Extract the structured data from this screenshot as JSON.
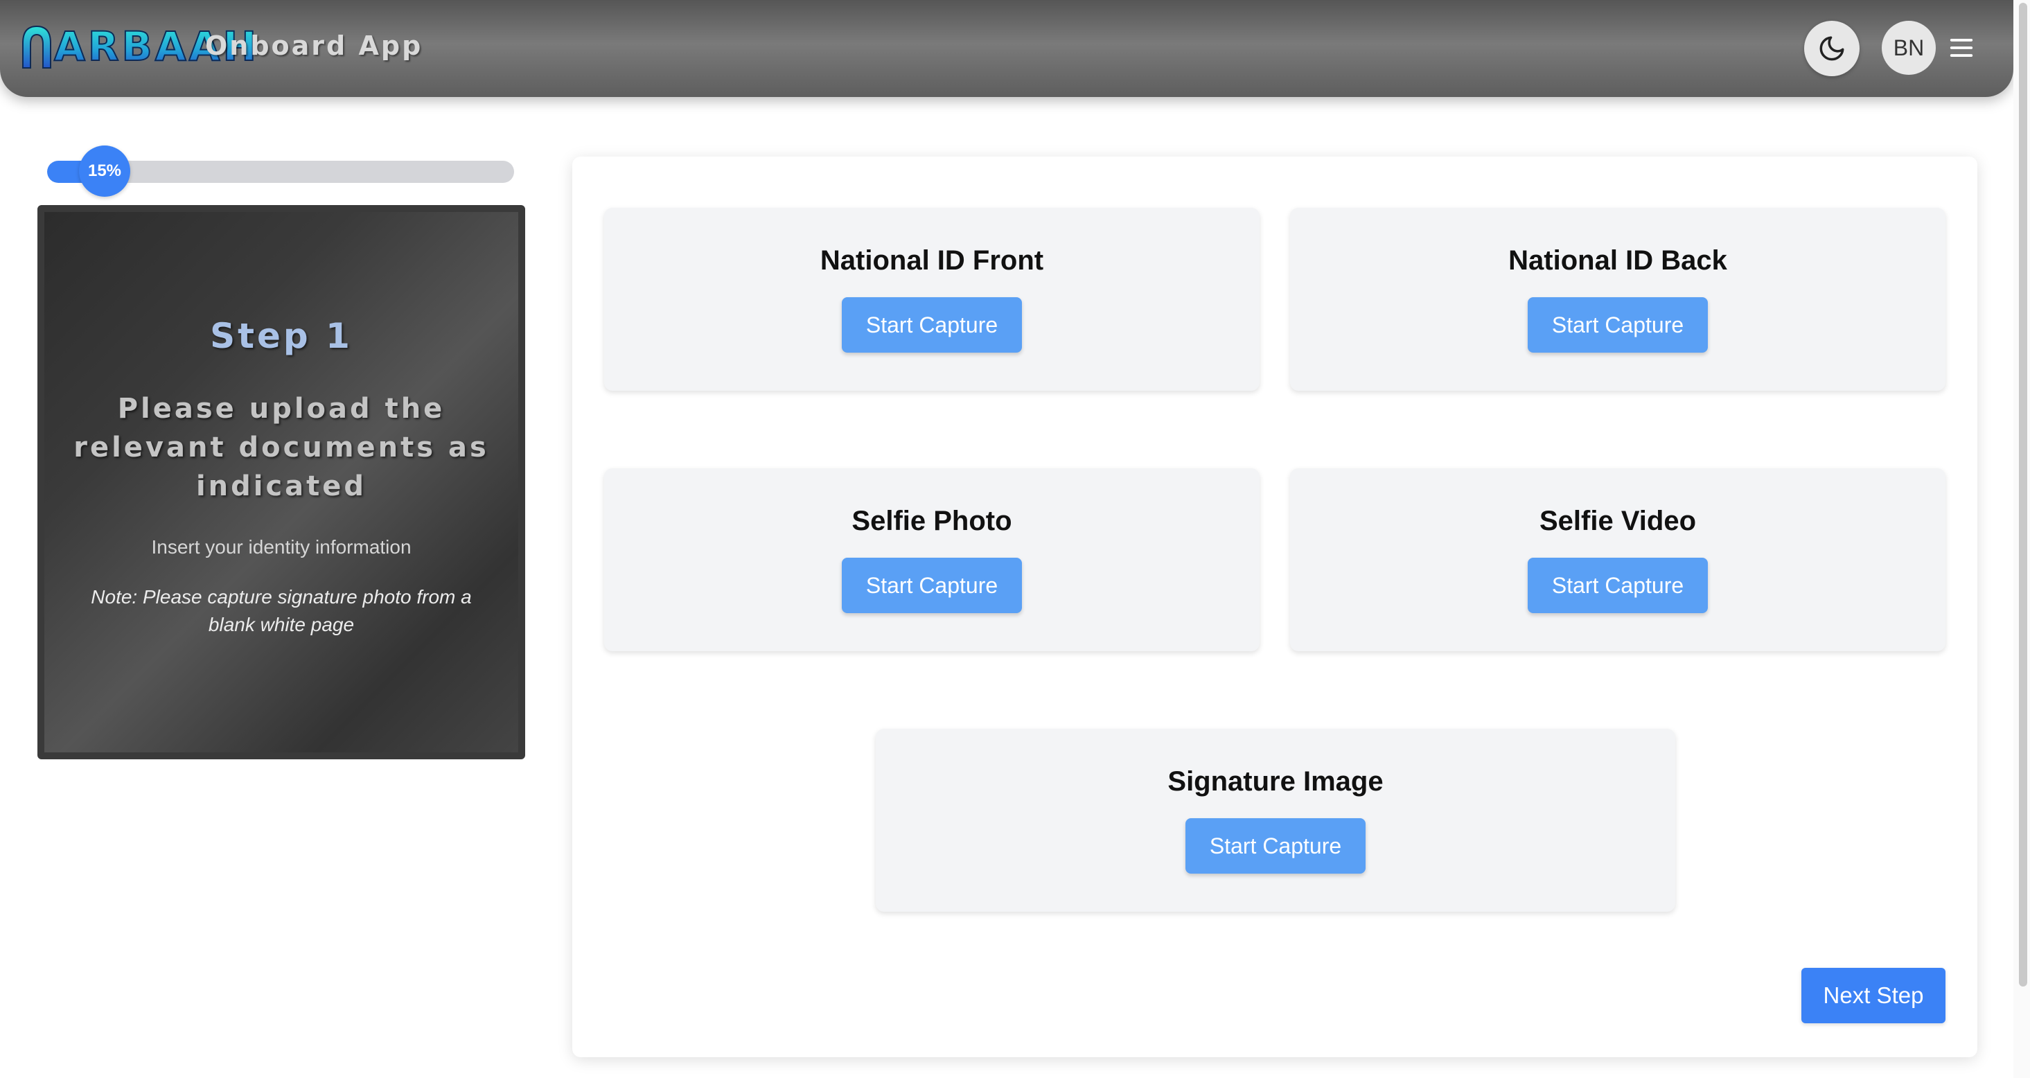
{
  "header": {
    "logo_text": "ARBAAH",
    "app_name": "Onboard App",
    "theme_toggle_icon": "moon-icon",
    "avatar_initials": "BN",
    "menu_icon": "hamburger-menu-icon"
  },
  "progress": {
    "percent_label": "15%",
    "value_fraction": 0.15,
    "color": "#3b82f6"
  },
  "step": {
    "title": "Step 1",
    "heading": "Please upload the relevant documents as indicated",
    "subtitle": "Insert your identity information",
    "note": "Note: Please capture signature photo from a blank white page"
  },
  "captures": [
    {
      "title": "National ID Front",
      "button_label": "Start Capture"
    },
    {
      "title": "National ID Back",
      "button_label": "Start Capture"
    },
    {
      "title": "Selfie Photo",
      "button_label": "Start Capture"
    },
    {
      "title": "Selfie Video",
      "button_label": "Start Capture"
    },
    {
      "title": "Signature Image",
      "button_label": "Start Capture"
    }
  ],
  "next_button_label": "Next Step",
  "colors": {
    "accent": "#3b82f6",
    "capture_button": "#5aa0f5",
    "tile_background": "#f3f4f6"
  }
}
